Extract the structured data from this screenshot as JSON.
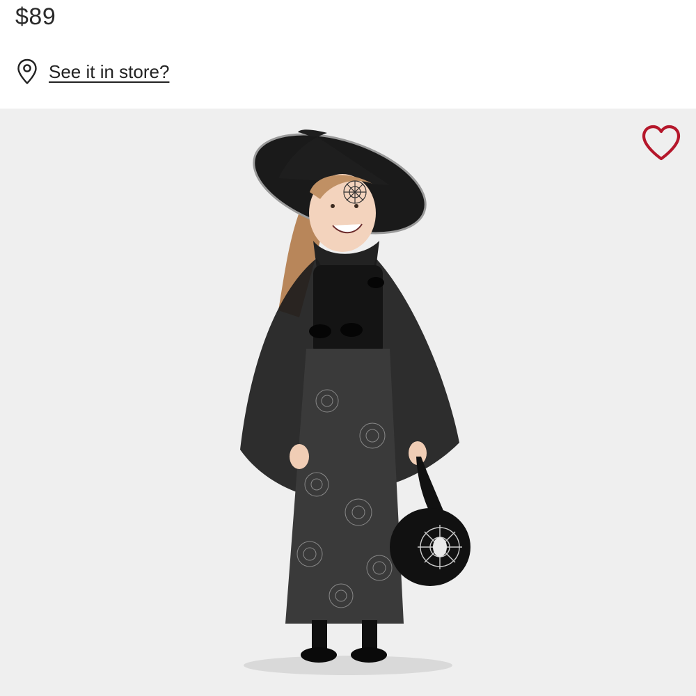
{
  "product": {
    "price": "$89"
  },
  "store": {
    "link_label": "See it in store?",
    "icon": "location-pin-icon"
  },
  "gallery": {
    "favorite_icon": "heart-outline-icon",
    "favorite_color": "#b5172b",
    "background_color": "#efefef"
  }
}
